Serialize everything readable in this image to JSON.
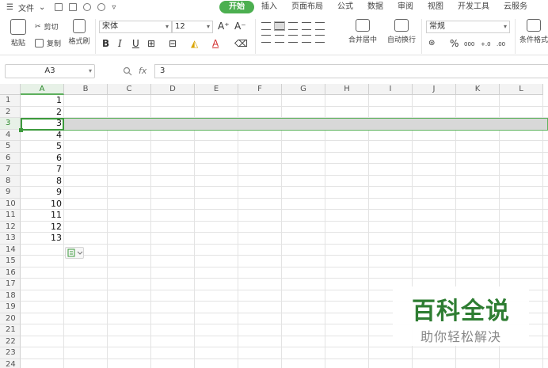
{
  "menu": {
    "file_label": "文件",
    "tabs": [
      {
        "label": "开始",
        "active": true
      },
      {
        "label": "插入"
      },
      {
        "label": "页面布局"
      },
      {
        "label": "公式"
      },
      {
        "label": "数据"
      },
      {
        "label": "审阅"
      },
      {
        "label": "视图"
      },
      {
        "label": "开发工具"
      },
      {
        "label": "云服务"
      }
    ]
  },
  "ribbon": {
    "paste": "粘贴",
    "cut": "剪切",
    "copy": "复制",
    "format_painter": "格式刷",
    "font_name": "宋体",
    "font_size": "12",
    "bold": "B",
    "italic": "I",
    "underline": "U",
    "merge_center": "合并居中",
    "wrap_text": "自动换行",
    "number_format": "常规",
    "percent": "%",
    "thousands": "000",
    "inc_decimal": "+.0",
    "dec_decimal": ".00",
    "conditional_format": "条件格式"
  },
  "formula_bar": {
    "cell_ref": "A3",
    "fx": "fx",
    "content": "3"
  },
  "sheet": {
    "columns": [
      "A",
      "B",
      "C",
      "D",
      "E",
      "F",
      "G",
      "H",
      "I",
      "J",
      "K",
      "L"
    ],
    "rows": [
      "1",
      "2",
      "3",
      "4",
      "5",
      "6",
      "7",
      "8",
      "9",
      "10",
      "11",
      "12",
      "13",
      "14",
      "15",
      "16",
      "17",
      "18",
      "19",
      "20",
      "21",
      "22",
      "23",
      "24"
    ],
    "selected_row": 3,
    "column_a_values": [
      "1",
      "2",
      "3",
      "4",
      "5",
      "6",
      "7",
      "8",
      "9",
      "10",
      "11",
      "12",
      "13"
    ]
  },
  "watermark": {
    "title": "百科全说",
    "subtitle": "助你轻松解决"
  },
  "colors": {
    "accent": "#4caf50",
    "selection_border": "#3c9a3c",
    "selected_row_fill": "#d8d8d8"
  }
}
